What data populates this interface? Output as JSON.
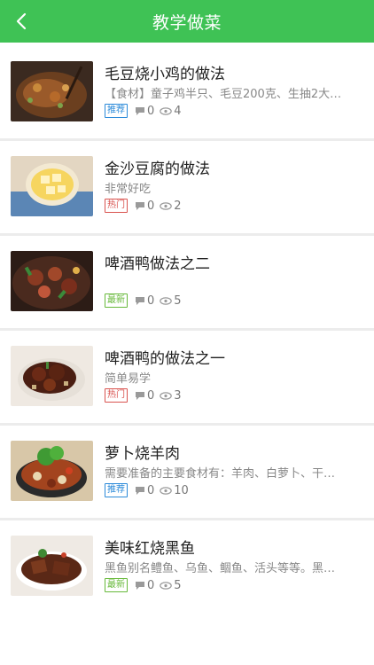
{
  "header": {
    "title": "教学做菜",
    "background": "#3fc255"
  },
  "recipes": [
    {
      "name": "毛豆烧小鸡的做法",
      "desc": "【食材】童子鸡半只、毛豆200克、生抽2大…",
      "tag": "推荐",
      "tag_color": "#2b8ad9",
      "comments": "0",
      "views": "4"
    },
    {
      "name": "金沙豆腐的做法",
      "desc": "非常好吃",
      "tag": "热门",
      "tag_color": "#d9534f",
      "comments": "0",
      "views": "2"
    },
    {
      "name": "啤酒鸭做法之二",
      "desc": "",
      "tag": "最新",
      "tag_color": "#67b93a",
      "comments": "0",
      "views": "5"
    },
    {
      "name": "啤酒鸭的做法之一",
      "desc": "简单易学",
      "tag": "热门",
      "tag_color": "#d9534f",
      "comments": "0",
      "views": "3"
    },
    {
      "name": "萝卜烧羊肉",
      "desc": "需要准备的主要食材有：羊肉、白萝卜、干…",
      "tag": "推荐",
      "tag_color": "#2b8ad9",
      "comments": "0",
      "views": "10"
    },
    {
      "name": "美味红烧黑鱼",
      "desc": "黑鱼别名鳢鱼、乌鱼、鲴鱼、活头等等。黑…",
      "tag": "最新",
      "tag_color": "#67b93a",
      "comments": "0",
      "views": "5"
    }
  ]
}
